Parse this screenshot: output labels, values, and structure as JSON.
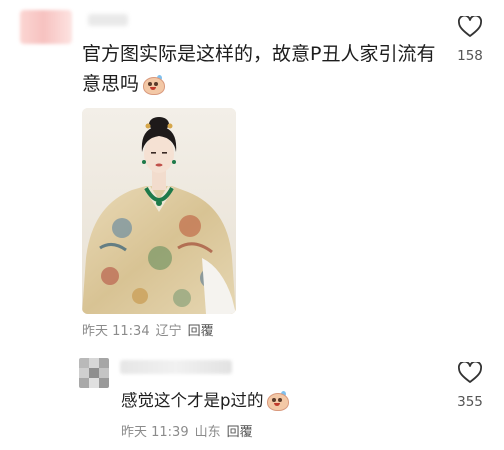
{
  "comments": [
    {
      "text": "官方图实际是这样的，故意P丑人家引流有意思吗",
      "emoji_icon": "sweat-smile-emoji-icon",
      "time": "昨天 11:34",
      "location": "辽宁",
      "reply_label": "回覆",
      "likes": "158"
    },
    {
      "text": "感觉这个才是p过的",
      "emoji_icon": "sweat-smile-emoji-icon",
      "time": "昨天 11:39",
      "location": "山东",
      "reply_label": "回覆",
      "likes": "355"
    }
  ],
  "icons": {
    "like": "heart-outline-icon"
  },
  "colors": {
    "text": "#1d1d1d",
    "meta": "#8b8b8b",
    "like_count": "#555555"
  }
}
